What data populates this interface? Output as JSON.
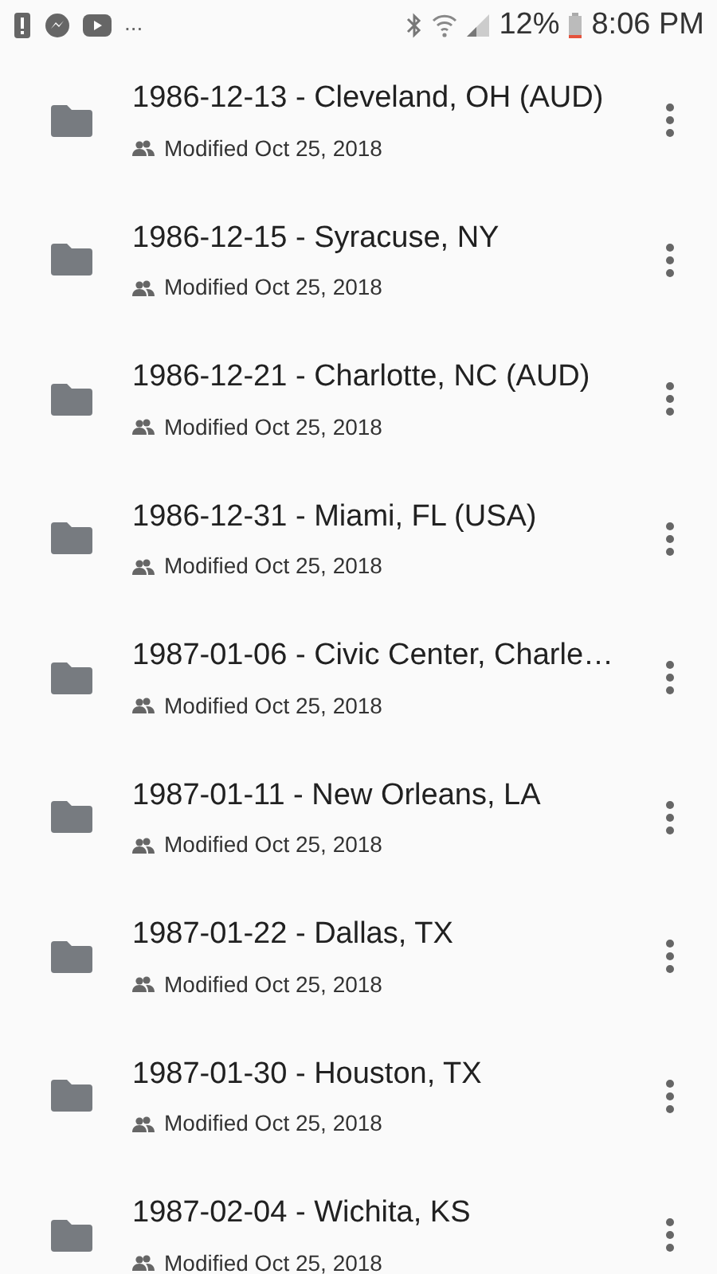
{
  "status_bar": {
    "overflow": "...",
    "battery_percent": "12%",
    "time": "8:06 PM"
  },
  "files": [
    {
      "name": "1986-12-13 - Cleveland, OH (AUD)",
      "modified": "Modified Oct 25, 2018"
    },
    {
      "name": "1986-12-15 - Syracuse, NY",
      "modified": "Modified Oct 25, 2018"
    },
    {
      "name": "1986-12-21 - Charlotte, NC (AUD)",
      "modified": "Modified Oct 25, 2018"
    },
    {
      "name": "1986-12-31 - Miami, FL (USA)",
      "modified": "Modified Oct 25, 2018"
    },
    {
      "name": "1987-01-06 - Civic Center, Charle…",
      "modified": "Modified Oct 25, 2018"
    },
    {
      "name": "1987-01-11 - New Orleans, LA",
      "modified": "Modified Oct 25, 2018"
    },
    {
      "name": "1987-01-22 - Dallas, TX",
      "modified": "Modified Oct 25, 2018"
    },
    {
      "name": "1987-01-30 - Houston, TX",
      "modified": "Modified Oct 25, 2018"
    },
    {
      "name": "1987-02-04 - Wichita, KS",
      "modified": "Modified Oct 25, 2018"
    }
  ]
}
